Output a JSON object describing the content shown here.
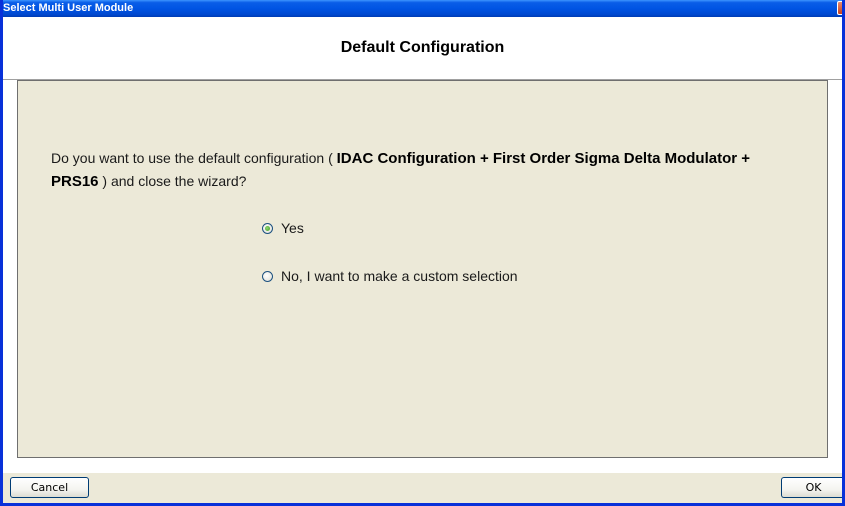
{
  "window": {
    "title": "Select Multi User Module"
  },
  "header": {
    "heading": "Default Configuration"
  },
  "question": {
    "prefix": "Do you want to use the default configuration ( ",
    "config_name": "IDAC Configuration + First Order Sigma Delta Modulator + PRS16",
    "suffix": " ) and close the wizard?"
  },
  "options": [
    {
      "label": "Yes",
      "selected": true
    },
    {
      "label": "No, I want to make a custom selection",
      "selected": false
    }
  ],
  "footer": {
    "cancel_label": "Cancel",
    "ok_label": "OK"
  },
  "colors": {
    "titlebar": "#0054e3",
    "dialog_bg": "#ece9d8",
    "header_bg": "#ffffff",
    "radio_selected": "#3f9a21"
  }
}
